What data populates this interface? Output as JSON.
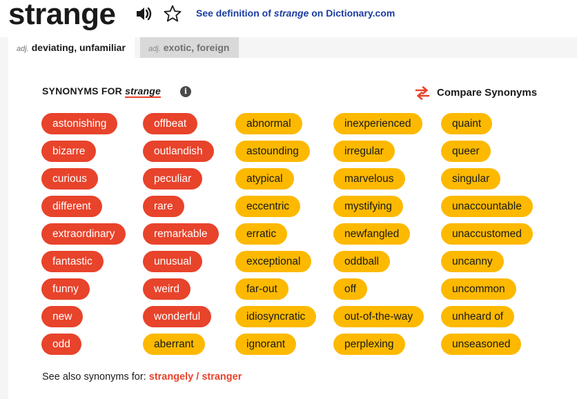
{
  "header": {
    "word": "strange",
    "definition_prefix": "See definition of",
    "definition_word": "strange",
    "definition_suffix": "on Dictionary.com",
    "icons": {
      "speaker": "speaker-icon",
      "favorite": "star-icon"
    }
  },
  "tabs": [
    {
      "pos": "adj.",
      "label": "deviating, unfamiliar",
      "active": true
    },
    {
      "pos": "adj.",
      "label": "exotic, foreign",
      "active": false
    }
  ],
  "synonyms_header": {
    "prefix": "SYNONYMS FOR",
    "word": "strange",
    "info_glyph": "i"
  },
  "compare": {
    "label": "Compare Synonyms",
    "icon": "compare-arrows-icon"
  },
  "colors": {
    "strong": "#e8432b",
    "weak": "#fcb900",
    "link": "#1a3ca0"
  },
  "columns": [
    [
      {
        "label": "astonishing",
        "relevance": "strong"
      },
      {
        "label": "bizarre",
        "relevance": "strong"
      },
      {
        "label": "curious",
        "relevance": "strong"
      },
      {
        "label": "different",
        "relevance": "strong"
      },
      {
        "label": "extraordinary",
        "relevance": "strong"
      },
      {
        "label": "fantastic",
        "relevance": "strong"
      },
      {
        "label": "funny",
        "relevance": "strong"
      },
      {
        "label": "new",
        "relevance": "strong"
      },
      {
        "label": "odd",
        "relevance": "strong"
      }
    ],
    [
      {
        "label": "offbeat",
        "relevance": "strong"
      },
      {
        "label": "outlandish",
        "relevance": "strong"
      },
      {
        "label": "peculiar",
        "relevance": "strong"
      },
      {
        "label": "rare",
        "relevance": "strong"
      },
      {
        "label": "remarkable",
        "relevance": "strong"
      },
      {
        "label": "unusual",
        "relevance": "strong"
      },
      {
        "label": "weird",
        "relevance": "strong"
      },
      {
        "label": "wonderful",
        "relevance": "strong"
      },
      {
        "label": "aberrant",
        "relevance": "weak"
      }
    ],
    [
      {
        "label": "abnormal",
        "relevance": "weak"
      },
      {
        "label": "astounding",
        "relevance": "weak"
      },
      {
        "label": "atypical",
        "relevance": "weak"
      },
      {
        "label": "eccentric",
        "relevance": "weak"
      },
      {
        "label": "erratic",
        "relevance": "weak"
      },
      {
        "label": "exceptional",
        "relevance": "weak"
      },
      {
        "label": "far-out",
        "relevance": "weak"
      },
      {
        "label": "idiosyncratic",
        "relevance": "weak"
      },
      {
        "label": "ignorant",
        "relevance": "weak"
      }
    ],
    [
      {
        "label": "inexperienced",
        "relevance": "weak"
      },
      {
        "label": "irregular",
        "relevance": "weak"
      },
      {
        "label": "marvelous",
        "relevance": "weak"
      },
      {
        "label": "mystifying",
        "relevance": "weak"
      },
      {
        "label": "newfangled",
        "relevance": "weak"
      },
      {
        "label": "oddball",
        "relevance": "weak"
      },
      {
        "label": "off",
        "relevance": "weak"
      },
      {
        "label": "out-of-the-way",
        "relevance": "weak"
      },
      {
        "label": "perplexing",
        "relevance": "weak"
      }
    ],
    [
      {
        "label": "quaint",
        "relevance": "weak"
      },
      {
        "label": "queer",
        "relevance": "weak"
      },
      {
        "label": "singular",
        "relevance": "weak"
      },
      {
        "label": "unaccountable",
        "relevance": "weak"
      },
      {
        "label": "unaccustomed",
        "relevance": "weak"
      },
      {
        "label": "uncanny",
        "relevance": "weak"
      },
      {
        "label": "uncommon",
        "relevance": "weak"
      },
      {
        "label": "unheard of",
        "relevance": "weak"
      },
      {
        "label": "unseasoned",
        "relevance": "weak"
      }
    ]
  ],
  "see_also": {
    "prefix": "See also synonyms for:",
    "links": [
      "strangely",
      "stranger"
    ],
    "separator": "/"
  }
}
